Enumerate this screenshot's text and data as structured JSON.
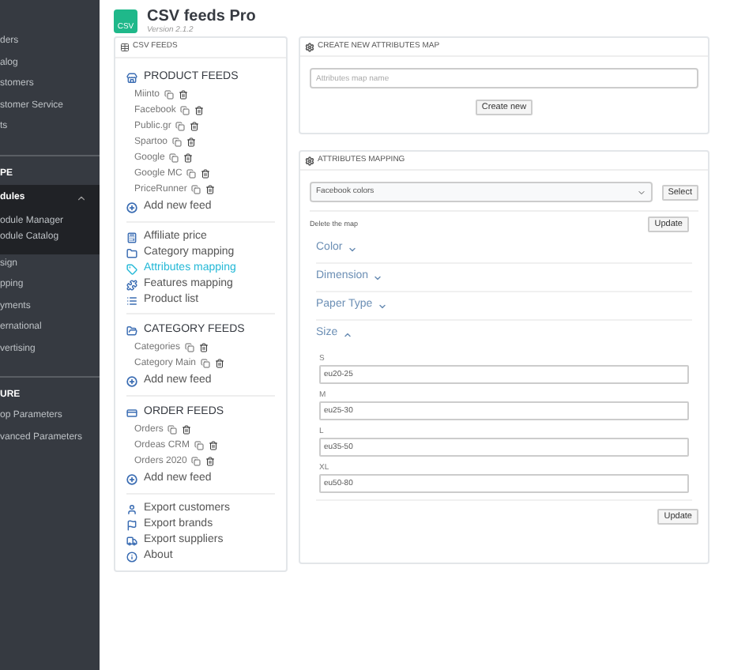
{
  "sidebar": {
    "groups": [
      {
        "items": [
          {
            "label": "ders",
            "selected": false
          },
          {
            "label": "alog",
            "selected": false
          },
          {
            "label": "stomers",
            "selected": false
          },
          {
            "label": "stomer Service",
            "selected": false
          },
          {
            "label": "ts",
            "selected": false
          }
        ]
      },
      {
        "heading": "PE",
        "items": [
          {
            "label": "dules",
            "selected": true,
            "expanded": true,
            "children": [
              {
                "label": "odule Manager"
              },
              {
                "label": "odule Catalog"
              }
            ]
          },
          {
            "label": "sign",
            "selected": false
          },
          {
            "label": "pping",
            "selected": false
          },
          {
            "label": "yments",
            "selected": false
          },
          {
            "label": "ernational",
            "selected": false
          },
          {
            "label": "vertising",
            "selected": false
          }
        ]
      },
      {
        "heading": "URE",
        "items": [
          {
            "label": "op Parameters",
            "selected": false
          },
          {
            "label": "vanced Parameters",
            "selected": false
          }
        ]
      }
    ]
  },
  "header": {
    "logo": "CSV",
    "title": "CSV feeds Pro",
    "version": "Version 2.1.2"
  },
  "feeds_panel": {
    "title": "CSV FEEDS",
    "sections": [
      {
        "kind": "feeds",
        "title": "PRODUCT FEEDS",
        "feeds": [
          "Miinto",
          "Facebook",
          "Public.gr",
          "Spartoo",
          "Google",
          "Google MC",
          "PriceRunner"
        ],
        "add": "Add new feed"
      },
      {
        "kind": "links",
        "items": [
          {
            "label": "Affiliate price",
            "selected": false
          },
          {
            "label": "Category mapping",
            "selected": false
          },
          {
            "label": "Attributes mapping",
            "selected": true
          },
          {
            "label": "Features mapping",
            "selected": false
          },
          {
            "label": "Product list",
            "selected": false
          }
        ]
      },
      {
        "kind": "feeds",
        "title": "CATEGORY FEEDS",
        "feeds": [
          "Categories",
          "Category Main"
        ],
        "add": "Add new feed"
      },
      {
        "kind": "feeds",
        "title": "ORDER FEEDS",
        "feeds": [
          "Orders",
          "Ordeas CRM",
          "Orders 2020"
        ],
        "add": "Add new feed"
      },
      {
        "kind": "links",
        "items": [
          {
            "label": "Export customers",
            "selected": false
          },
          {
            "label": "Export brands",
            "selected": false
          },
          {
            "label": "Export suppliers",
            "selected": false
          },
          {
            "label": "About",
            "selected": false
          }
        ]
      }
    ]
  },
  "create_panel": {
    "title": "CREATE NEW ATTRIBUTES MAP",
    "placeholder": "Attributes map name",
    "button": "Create new"
  },
  "mapping_panel": {
    "title": "ATTRIBUTES MAPPING",
    "select": "Facebook colors",
    "select_button": "Select",
    "delete_label": "Delete the map",
    "update_button": "Update",
    "attributes": [
      {
        "name": "Color",
        "expanded": false
      },
      {
        "name": "Dimension",
        "expanded": false
      },
      {
        "name": "Paper Type",
        "expanded": false
      },
      {
        "name": "Size",
        "expanded": true,
        "values": [
          {
            "label": "S",
            "value": "eu20-25"
          },
          {
            "label": "M",
            "value": "eu25-30"
          },
          {
            "label": "L",
            "value": "eu35-50"
          },
          {
            "label": "XL",
            "value": "eu50-80"
          }
        ]
      }
    ],
    "bottom_button": "Update"
  }
}
